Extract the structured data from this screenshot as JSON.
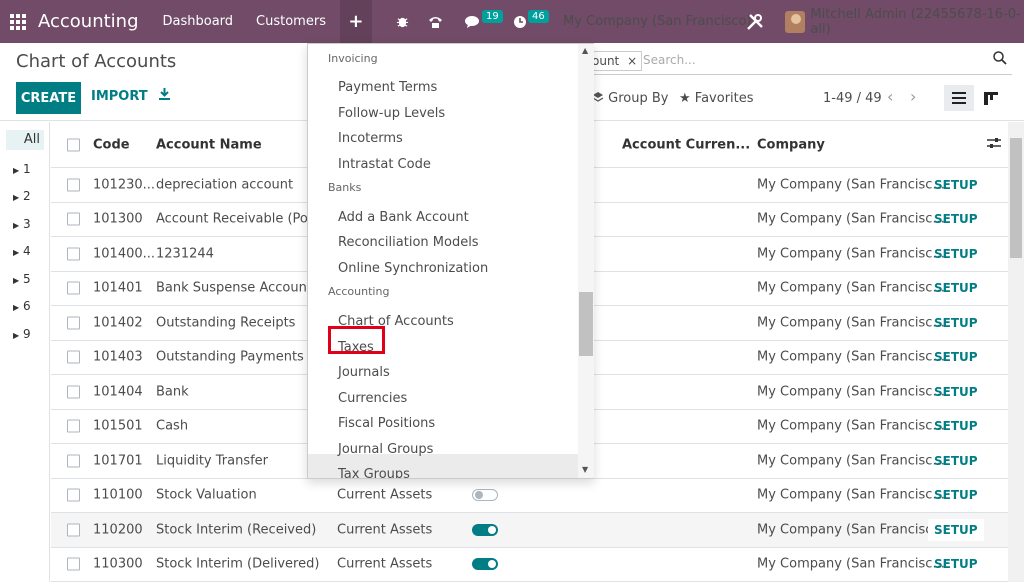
{
  "topbar": {
    "app_name": "Accounting",
    "menus": [
      "Dashboard",
      "Customers"
    ],
    "plus": "+",
    "chat_count": "19",
    "activity_count": "46",
    "company": "My Company (San Francisco)",
    "user": "Mitchell Admin (22455678-16-0-all)",
    "bg_color": "#714b67"
  },
  "control_panel": {
    "title": "Chart of Accounts",
    "create_label": "CREATE",
    "import_label": "IMPORT",
    "facet_text": "ount",
    "facet_remove": "×",
    "search_placeholder": "Search...",
    "group_by_label": "Group By",
    "favorites_label": "Favorites",
    "pager": "1-49 / 49",
    "accent_color": "#017e84"
  },
  "sidebar": {
    "all_label": "All",
    "items": [
      "1",
      "2",
      "3",
      "4",
      "5",
      "6",
      "9"
    ]
  },
  "table": {
    "columns": {
      "code": "Code",
      "name": "Account Name",
      "currency": "Account Curren...",
      "company": "Company"
    },
    "setup_label": "SETUP",
    "rows": [
      {
        "code": "101230...",
        "name": "depreciation account",
        "type": "",
        "toggle": "",
        "company": "My Company (San Francisc..."
      },
      {
        "code": "101300",
        "name": "Account Receivable (PoS)",
        "type": "",
        "toggle": "",
        "company": "My Company (San Francisc..."
      },
      {
        "code": "101400...",
        "name": "1231244",
        "type": "",
        "toggle": "",
        "company": "My Company (San Francisc..."
      },
      {
        "code": "101401",
        "name": "Bank Suspense Account",
        "type": "",
        "toggle": "",
        "company": "My Company (San Francisc..."
      },
      {
        "code": "101402",
        "name": "Outstanding Receipts",
        "type": "",
        "toggle": "",
        "company": "My Company (San Francisc..."
      },
      {
        "code": "101403",
        "name": "Outstanding Payments",
        "type": "",
        "toggle": "",
        "company": "My Company (San Francisc..."
      },
      {
        "code": "101404",
        "name": "Bank",
        "type": "",
        "toggle": "",
        "company": "My Company (San Francisc..."
      },
      {
        "code": "101501",
        "name": "Cash",
        "type": "",
        "toggle": "",
        "company": "My Company (San Francisc..."
      },
      {
        "code": "101701",
        "name": "Liquidity Transfer",
        "type": "",
        "toggle": "",
        "company": "My Company (San Francisc..."
      },
      {
        "code": "110100",
        "name": "Stock Valuation",
        "type": "Current Assets",
        "toggle": "off",
        "company": "My Company (San Francisc..."
      },
      {
        "code": "110200",
        "name": "Stock Interim (Received)",
        "type": "Current Assets",
        "toggle": "on",
        "company": "My Company (San Francisc..."
      },
      {
        "code": "110300",
        "name": "Stock Interim (Delivered)",
        "type": "Current Assets",
        "toggle": "on",
        "company": "My Company (San Francisc..."
      }
    ]
  },
  "dropdown": {
    "sections": [
      {
        "header": "Invoicing",
        "items": [
          "Payment Terms",
          "Follow-up Levels",
          "Incoterms",
          "Intrastat Code"
        ]
      },
      {
        "header": "Banks",
        "items": [
          "Add a Bank Account",
          "Reconciliation Models",
          "Online Synchronization"
        ]
      },
      {
        "header": "Accounting",
        "items": [
          "Chart of Accounts",
          "Taxes",
          "Journals",
          "Currencies",
          "Fiscal Positions",
          "Journal Groups",
          "Tax Groups"
        ]
      }
    ],
    "highlighted_item": "Taxes",
    "hover_item": "Tax Groups",
    "highlight_color": "#e0001a"
  }
}
